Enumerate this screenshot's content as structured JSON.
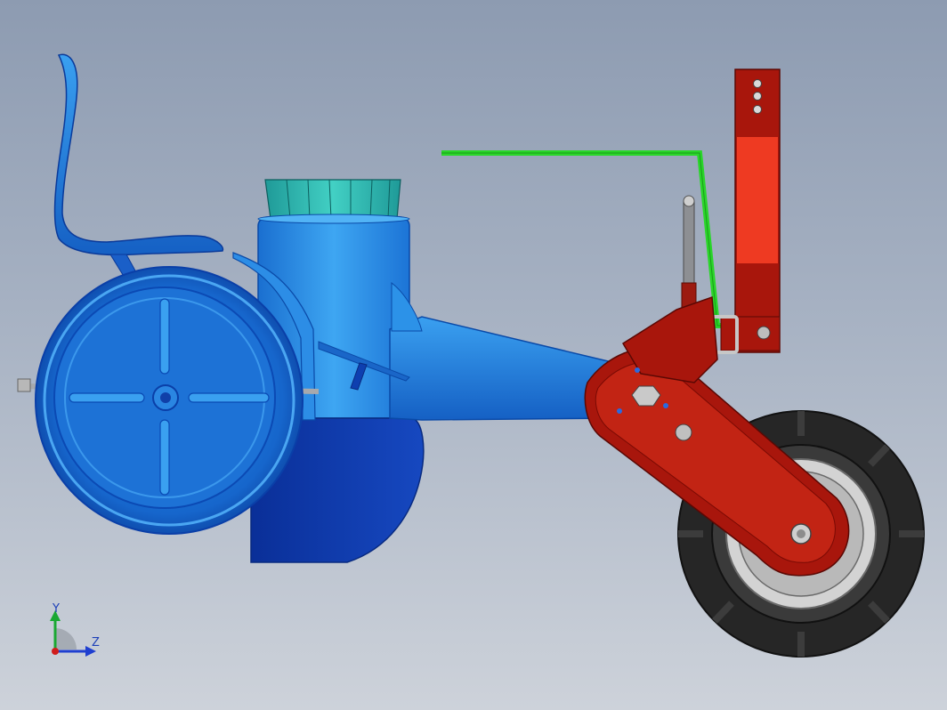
{
  "triad": {
    "y_label": "Y",
    "z_label": "Z",
    "y_color": "#1aa832",
    "z_color": "#1f3fd0",
    "x_color": "#d01c1c"
  },
  "model": {
    "colors": {
      "frame_blue": "#1a7ad6",
      "dark_blue": "#0a36a8",
      "teal": "#2bb8b0",
      "red": "#b3170c",
      "bright_red": "#ee3a22",
      "green_link": "#2ad62a",
      "tire": "#2a2a2a",
      "rim": "#c8c8c8"
    },
    "icons": [
      "seat-icon",
      "drive-wheel-icon",
      "hopper-icon",
      "frame-arm-icon",
      "gauge-wheel-icon",
      "hitch-bracket-icon",
      "linkage-rod-icon"
    ]
  }
}
